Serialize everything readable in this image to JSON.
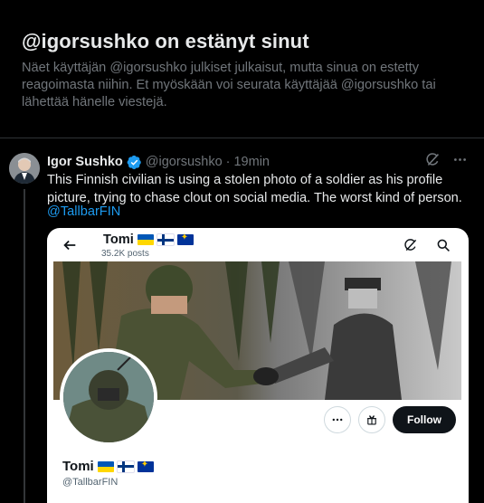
{
  "block": {
    "title": "@igorsushko on estänyt sinut",
    "description": "Näet käyttäjän @igorsushko julkiset julkaisut, mutta sinua on estetty reagoimasta niihin. Et myöskään voi seurata käyttäjää @igorsushko tai lähettää hänelle viestejä."
  },
  "tweet": {
    "author_name": "Igor Sushko",
    "handle": "@igorsushko",
    "separator": "·",
    "time": "19min",
    "text": "This Finnish civilian is using a stolen photo of a soldier as his profile picture, trying to chase clout on social media. The worst kind of person.",
    "mention": "@TallbarFIN",
    "icons": [
      "verified-badge-icon",
      "grok-icon",
      "more-icon"
    ]
  },
  "embedded": {
    "profile_name": "Tomi",
    "posts_count": "35.2K posts",
    "handle": "@TallbarFIN",
    "follow_label": "Follow",
    "icons": [
      "back-arrow-icon",
      "grok-icon",
      "search-icon",
      "more-icon",
      "subscribe-icon"
    ],
    "flags": [
      "ukraine-flag",
      "finland-flag",
      "eu-flag"
    ]
  },
  "colors": {
    "background": "#000000",
    "text_primary": "#e7e9ea",
    "text_secondary": "#71767b",
    "accent": "#1d9bf0",
    "divider": "#2f3336"
  }
}
